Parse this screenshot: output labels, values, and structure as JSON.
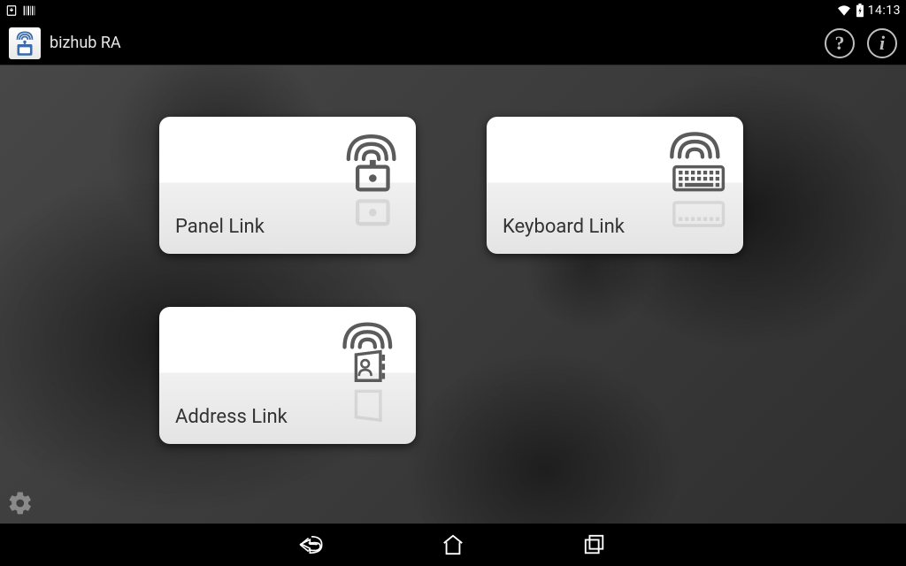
{
  "status": {
    "time": "14:13"
  },
  "app": {
    "title": "bizhub RA"
  },
  "tiles": {
    "panel": {
      "label": "Panel Link"
    },
    "keyboard": {
      "label": "Keyboard Link"
    },
    "address": {
      "label": "Address Link"
    }
  }
}
